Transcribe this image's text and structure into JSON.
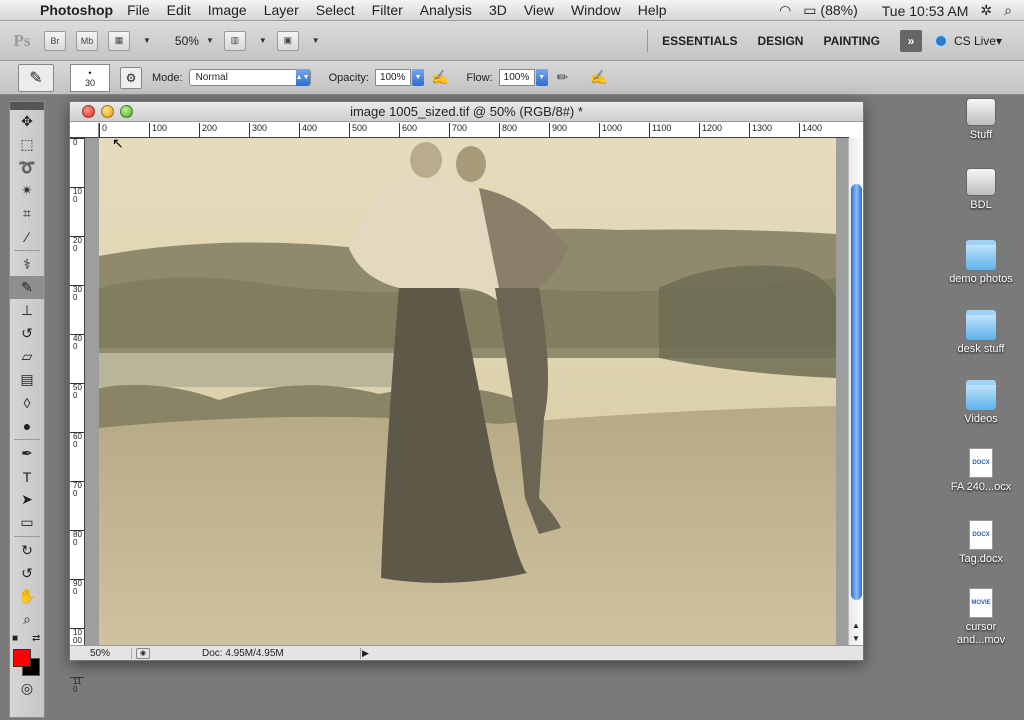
{
  "menubar": {
    "apple": "",
    "app_name": "Photoshop",
    "items": [
      "File",
      "Edit",
      "Image",
      "Layer",
      "Select",
      "Filter",
      "Analysis",
      "3D",
      "View",
      "Window",
      "Help"
    ],
    "battery": "(88%)",
    "clock": "Tue 10:53 AM",
    "wifi_icon": "wifi-icon",
    "search_icon": "spotlight-icon"
  },
  "appbar": {
    "logo": "Ps",
    "bridge": "Br",
    "minibridge": "Mb",
    "zoom": "50%",
    "workspaces": [
      "ESSENTIALS",
      "DESIGN",
      "PAINTING"
    ],
    "more": "»",
    "cs_live": "CS Live"
  },
  "options": {
    "brush_size": "30",
    "mode_label": "Mode:",
    "mode_value": "Normal",
    "opacity_label": "Opacity:",
    "opacity_value": "100%",
    "flow_label": "Flow:",
    "flow_value": "100%"
  },
  "document": {
    "title": "image 1005_sized.tif @ 50% (RGB/8#) *",
    "ruler_h": [
      "0",
      "100",
      "200",
      "300",
      "400",
      "500",
      "600",
      "700",
      "800",
      "900",
      "1000",
      "1100",
      "1200",
      "1300",
      "1400"
    ],
    "ruler_v": [
      "0",
      "1 0 0",
      "2 0 0",
      "3 0 0",
      "4 0 0",
      "5 0 0",
      "6 0 0",
      "7 0 0",
      "8 0 0",
      "9 0 0",
      "1 0 0 0",
      "1 1 0"
    ],
    "status_zoom": "50%",
    "status_doc": "Doc: 4.95M/4.95M"
  },
  "desktop": [
    {
      "label": "Stuff",
      "icon": "drive"
    },
    {
      "label": "BDL",
      "icon": "drive"
    },
    {
      "label": "demo photos",
      "icon": "folder"
    },
    {
      "label": "desk stuff",
      "icon": "folder"
    },
    {
      "label": "Videos",
      "icon": "folder"
    },
    {
      "label": "FA 240...ocx",
      "icon": "file"
    },
    {
      "label": "Tag.docx",
      "icon": "file"
    },
    {
      "label": "cursor and...mov",
      "icon": "file"
    }
  ],
  "file_badges": {
    "docx": "DOCX",
    "movie": "MOVIE"
  },
  "colors": {
    "foreground": "#ff0000",
    "background": "#000000",
    "scroll_accent": "#2a6fd6"
  }
}
